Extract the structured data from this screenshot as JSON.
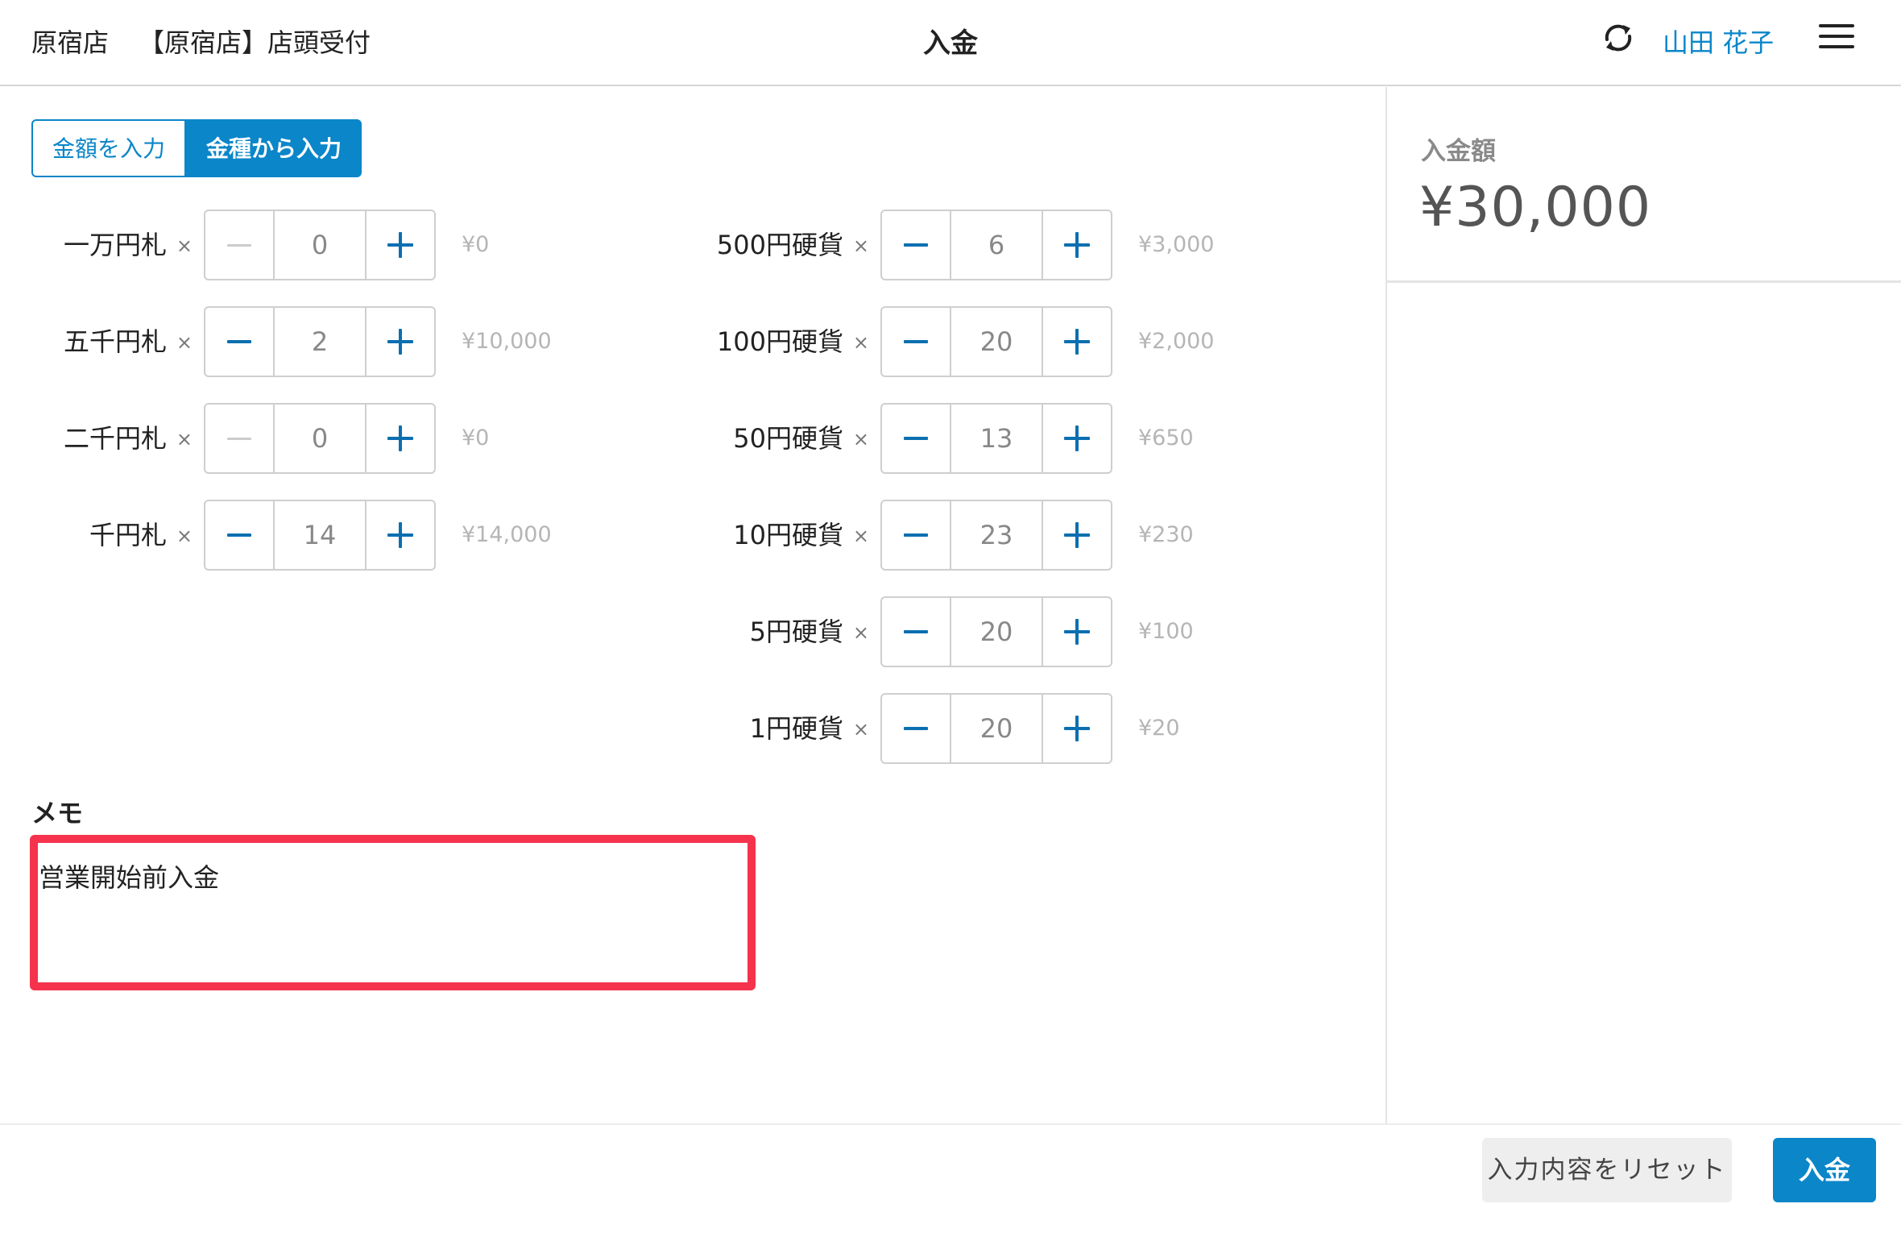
{
  "header": {
    "store": "原宿店",
    "register": "【原宿店】店頭受付",
    "title": "入金",
    "user": "山田 花子",
    "sync_icon": "sync-icon",
    "menu_icon": "hamburger-menu-icon"
  },
  "tabs": {
    "amount_label": "金額を入力",
    "denomination_label": "金種から入力",
    "active": "denomination"
  },
  "multiply_symbol": "×",
  "bills": [
    {
      "label": "一万円札",
      "quantity": "0",
      "subtotal": "¥0",
      "minus_disabled": true
    },
    {
      "label": "五千円札",
      "quantity": "2",
      "subtotal": "¥10,000",
      "minus_disabled": false
    },
    {
      "label": "二千円札",
      "quantity": "0",
      "subtotal": "¥0",
      "minus_disabled": true
    },
    {
      "label": "千円札",
      "quantity": "14",
      "subtotal": "¥14,000",
      "minus_disabled": false
    }
  ],
  "coins": [
    {
      "label": "500円硬貨",
      "quantity": "6",
      "subtotal": "¥3,000",
      "minus_disabled": false
    },
    {
      "label": "100円硬貨",
      "quantity": "20",
      "subtotal": "¥2,000",
      "minus_disabled": false
    },
    {
      "label": "50円硬貨",
      "quantity": "13",
      "subtotal": "¥650",
      "minus_disabled": false
    },
    {
      "label": "10円硬貨",
      "quantity": "23",
      "subtotal": "¥230",
      "minus_disabled": false
    },
    {
      "label": "5円硬貨",
      "quantity": "20",
      "subtotal": "¥100",
      "minus_disabled": false
    },
    {
      "label": "1円硬貨",
      "quantity": "20",
      "subtotal": "¥20",
      "minus_disabled": false
    }
  ],
  "memo": {
    "label": "メモ",
    "value": "営業開始前入金"
  },
  "summary": {
    "label": "入金額",
    "amount": "¥30,000"
  },
  "footer": {
    "reset_label": "入力内容をリセット",
    "submit_label": "入金"
  },
  "colors": {
    "accent": "#0a86c9",
    "highlight": "#f5334d"
  }
}
